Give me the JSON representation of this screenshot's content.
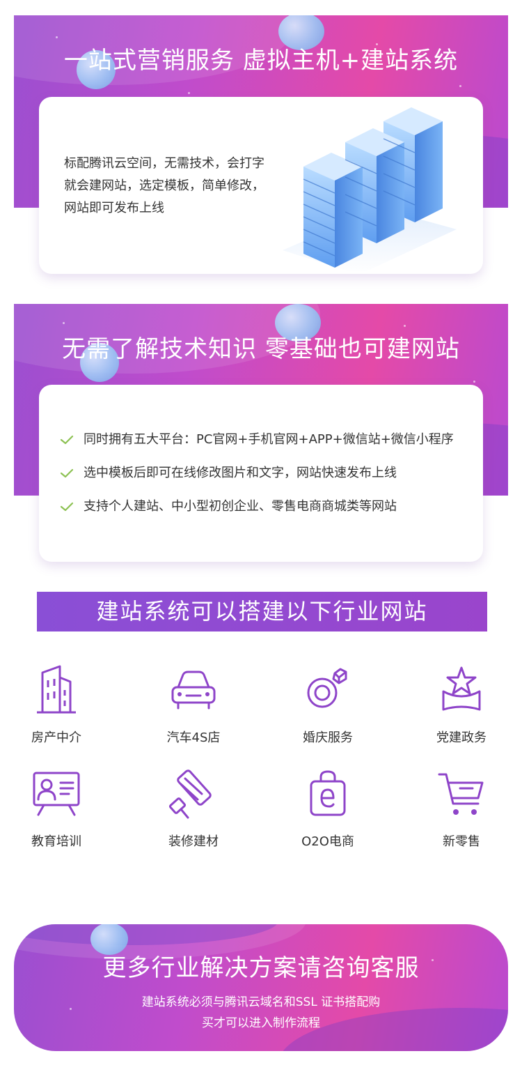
{
  "banner1": {
    "title": "一站式营销服务 虚拟主机+建站系统",
    "intro_lines": [
      "标配腾讯云空间，无需技术，会打字",
      "就会建网站，选定模板，简单修改，",
      "网站即可发布上线"
    ],
    "illustration": "server-rack-illustration"
  },
  "banner2": {
    "title": "无需了解技术知识  零基础也可建网站",
    "features": [
      "同时拥有五大平台：PC官网+手机官网+APP+微信站+微信小程序",
      "选中模板后即可在线修改图片和文字，网站快速发布上线",
      "支持个人建站、中小型初创企业、零售电商商城类等网站"
    ]
  },
  "industries": {
    "heading": "建站系统可以搭建以下行业网站",
    "items": [
      {
        "label": "房产中介",
        "icon": "building-icon"
      },
      {
        "label": "汽车4S店",
        "icon": "car-icon"
      },
      {
        "label": "婚庆服务",
        "icon": "ring-icon"
      },
      {
        "label": "党建政务",
        "icon": "star-award-icon"
      },
      {
        "label": "教育培训",
        "icon": "presentation-board-icon"
      },
      {
        "label": "装修建材",
        "icon": "paint-roller-icon"
      },
      {
        "label": "O2O电商",
        "icon": "shopping-bag-icon"
      },
      {
        "label": "新零售",
        "icon": "shopping-cart-icon"
      }
    ]
  },
  "footer": {
    "title": "更多行业解决方案请咨询客服",
    "sub_lines": [
      "建站系统必须与腾讯云域名和SSL 证书搭配购",
      "买才可以进入制作流程"
    ]
  },
  "colors": {
    "brand_purple": "#8a4fd6",
    "icon_purple": "#8e44c9",
    "check_green": "#8cc152",
    "banner_pink": "#e44aa8"
  }
}
